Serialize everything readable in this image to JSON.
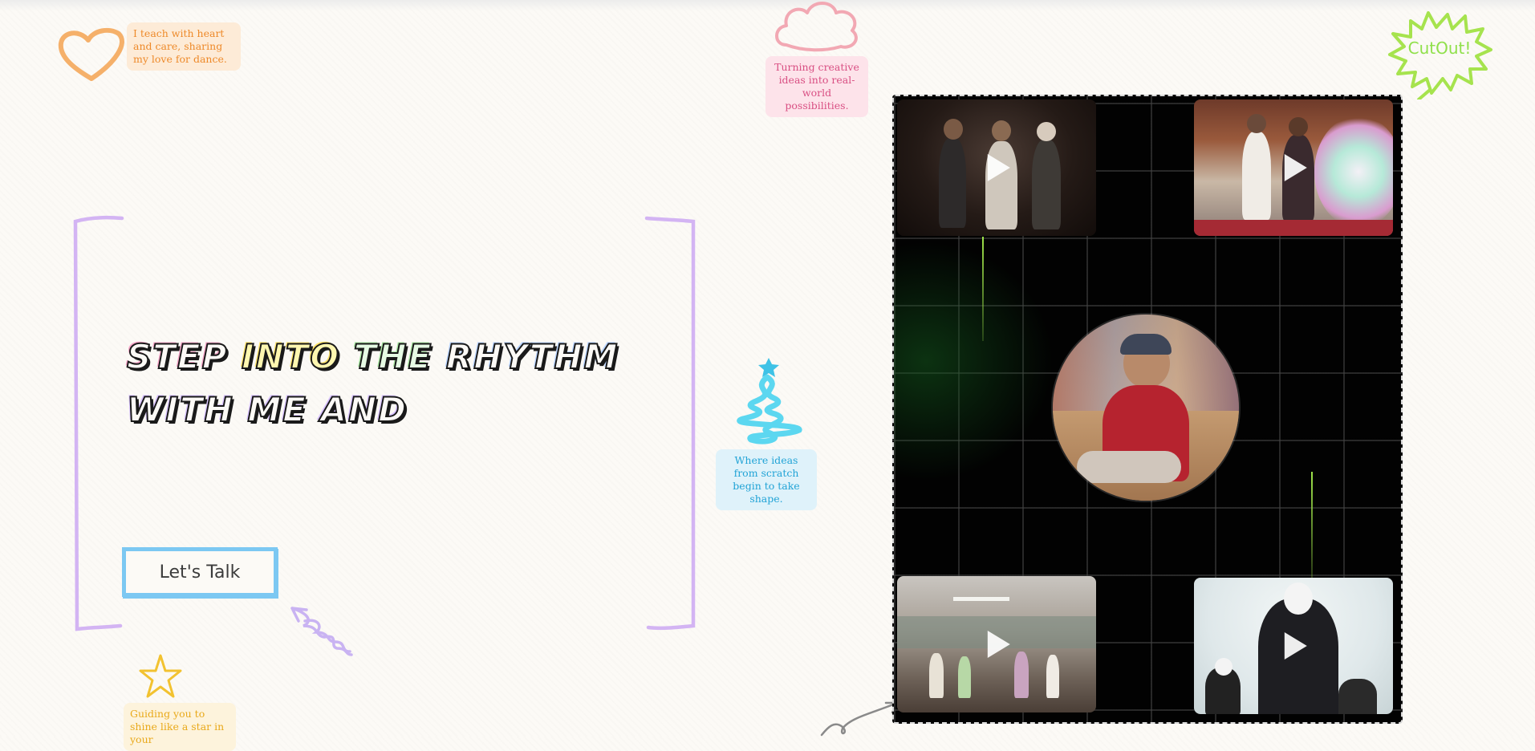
{
  "notes": {
    "heart": "I teach with heart and care, sharing my love for dance.",
    "cloud": "Turning creative ideas into real-world possibilities.",
    "tree": "Where ideas from scratch begin to take shape.",
    "star": "Guiding you to shine like a star in your"
  },
  "hero": {
    "line1": [
      "STEP",
      "INTO",
      "THE",
      "RHYTHM"
    ],
    "line2": "WITH ME AND",
    "cta_label": "Let's Talk"
  },
  "sticker": {
    "label": "CutOut!"
  },
  "gallery": {
    "videos": [
      {
        "name": "dance-video-1",
        "icon": "play-icon"
      },
      {
        "name": "dance-video-2",
        "icon": "play-icon"
      },
      {
        "name": "dance-video-3",
        "icon": "play-icon"
      },
      {
        "name": "dance-video-4",
        "icon": "play-icon"
      }
    ]
  },
  "colors": {
    "orange": "#f5a651",
    "pink": "#f2a2b2",
    "purple": "#d3b4f3",
    "blue": "#7cc8f2",
    "cyan": "#5cd7f0",
    "yellow": "#f2c230",
    "lime": "#a6e34e"
  }
}
